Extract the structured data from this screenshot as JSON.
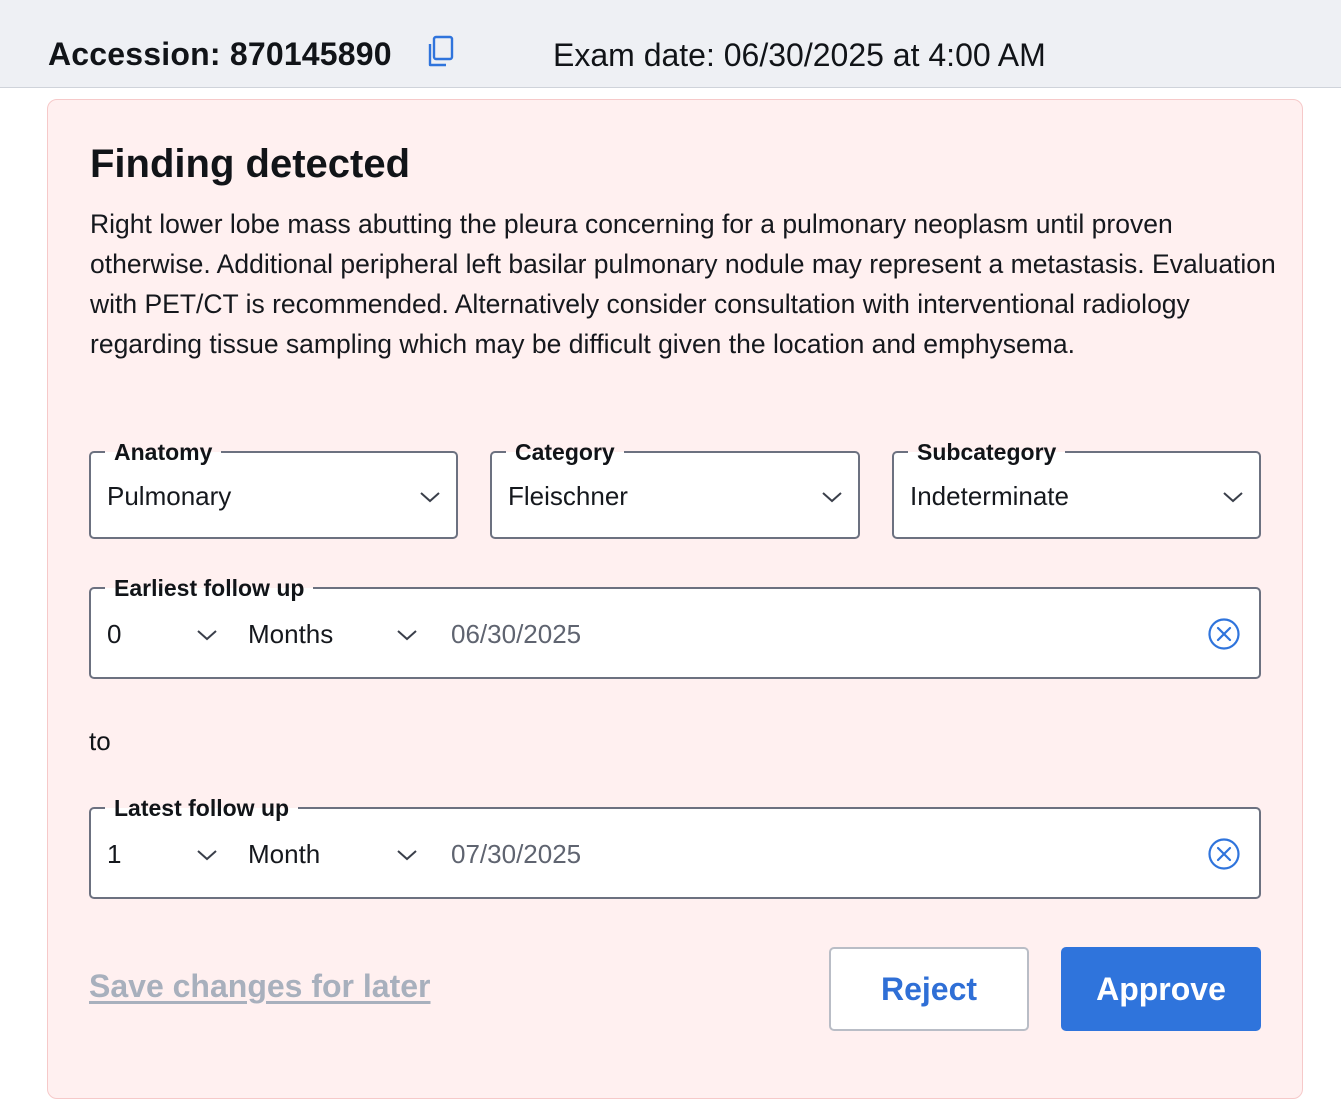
{
  "header": {
    "accession": "Accession: 870145890",
    "exam_date": "Exam date: 06/30/2025 at 4:00 AM"
  },
  "finding": {
    "title": "Finding detected",
    "description": "Right lower lobe mass abutting the pleura concerning for a pulmonary neoplasm until proven otherwise. Additional peripheral left basilar pulmonary nodule may represent a metastasis. Evaluation with PET/CT is recommended. Alternatively consider consultation with interventional radiology regarding tissue sampling which may be difficult given the location and emphysema."
  },
  "selects": {
    "anatomy": {
      "label": "Anatomy",
      "value": "Pulmonary"
    },
    "category": {
      "label": "Category",
      "value": "Fleischner"
    },
    "subcategory": {
      "label": "Subcategory",
      "value": "Indeterminate"
    }
  },
  "earliest": {
    "label": "Earliest follow up",
    "amount": "0",
    "unit": "Months",
    "date": "06/30/2025"
  },
  "to_label": "to",
  "latest": {
    "label": "Latest follow up",
    "amount": "1",
    "unit": "Month",
    "date": "07/30/2025"
  },
  "actions": {
    "save": "Save changes for later",
    "reject": "Reject",
    "approve": "Approve"
  },
  "colors": {
    "accent": "#2f74dc",
    "card_bg": "#fff0f0",
    "card_border": "#f6c9c9",
    "disabled_link": "#a8b0bd"
  },
  "icons": {
    "copy": "copy-icon",
    "chevron": "chevron-down-icon",
    "clear": "clear-circle-x-icon"
  }
}
